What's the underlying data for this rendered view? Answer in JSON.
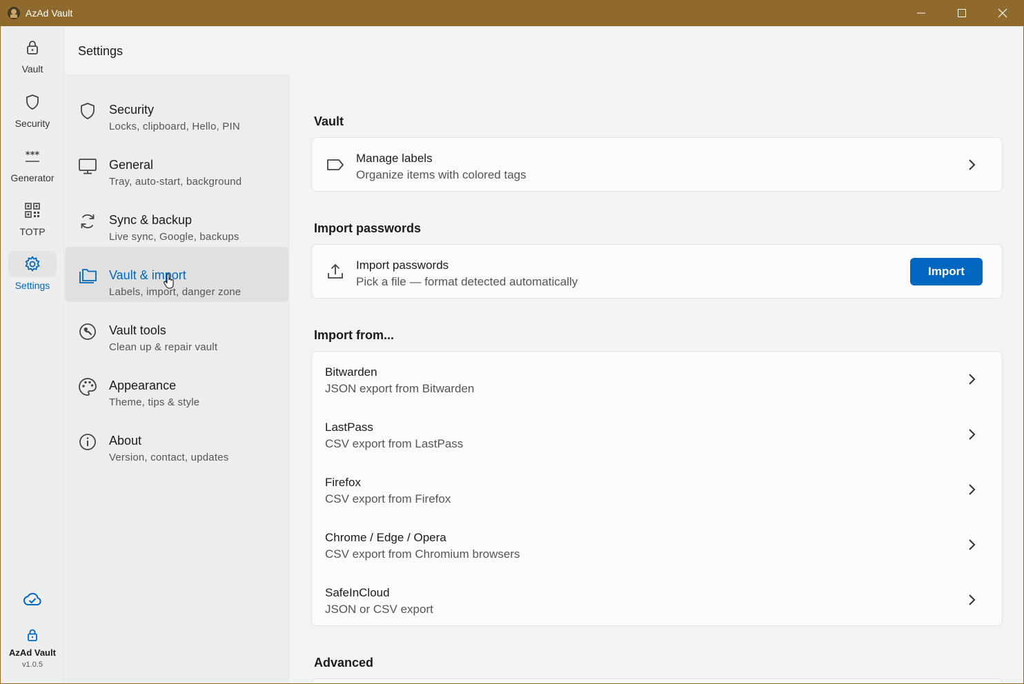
{
  "window": {
    "title": "AzAd Vault"
  },
  "rail": {
    "items": [
      {
        "label": "Vault",
        "icon": "lock-icon"
      },
      {
        "label": "Security",
        "icon": "shield-icon"
      },
      {
        "label": "Generator",
        "icon": "password-icon"
      },
      {
        "label": "TOTP",
        "icon": "qr-code-icon"
      },
      {
        "label": "Settings",
        "icon": "gear-icon",
        "active": true
      }
    ],
    "sync_status_icon": "cloud-check-icon",
    "footer": {
      "name": "AzAd Vault",
      "version": "v1.0.5"
    }
  },
  "header": {
    "title": "Settings"
  },
  "categories": [
    {
      "title": "Security",
      "subtitle": "Locks, clipboard, Hello, PIN",
      "icon": "shield-icon"
    },
    {
      "title": "General",
      "subtitle": "Tray, auto-start, background",
      "icon": "monitor-icon"
    },
    {
      "title": "Sync & backup",
      "subtitle": "Live sync, Google, backups",
      "icon": "sync-icon"
    },
    {
      "title": "Vault & import",
      "subtitle": "Labels, import, danger zone",
      "icon": "folders-icon",
      "active": true
    },
    {
      "title": "Vault tools",
      "subtitle": "Clean up & repair vault",
      "icon": "wrench-icon"
    },
    {
      "title": "Appearance",
      "subtitle": "Theme, tips & style",
      "icon": "palette-icon"
    },
    {
      "title": "About",
      "subtitle": "Version, contact, updates",
      "icon": "info-icon"
    }
  ],
  "main": {
    "vault": {
      "heading": "Vault",
      "manage_labels": {
        "title": "Manage labels",
        "subtitle": "Organize items with colored tags",
        "icon": "tag-icon"
      }
    },
    "import_passwords": {
      "heading": "Import passwords",
      "row": {
        "title": "Import passwords",
        "subtitle": "Pick a file — format detected automatically",
        "icon": "upload-icon"
      },
      "button_label": "Import"
    },
    "import_from": {
      "heading": "Import from...",
      "sources": [
        {
          "title": "Bitwarden",
          "subtitle": "JSON export from Bitwarden"
        },
        {
          "title": "LastPass",
          "subtitle": "CSV export from LastPass"
        },
        {
          "title": "Firefox",
          "subtitle": "CSV export from Firefox"
        },
        {
          "title": "Chrome / Edge / Opera",
          "subtitle": "CSV export from Chromium browsers"
        },
        {
          "title": "SafeInCloud",
          "subtitle": "JSON or CSV export"
        }
      ]
    },
    "advanced": {
      "heading": "Advanced"
    }
  },
  "colors": {
    "titlebar": "#8f6a2c",
    "accent": "#0067c0"
  }
}
